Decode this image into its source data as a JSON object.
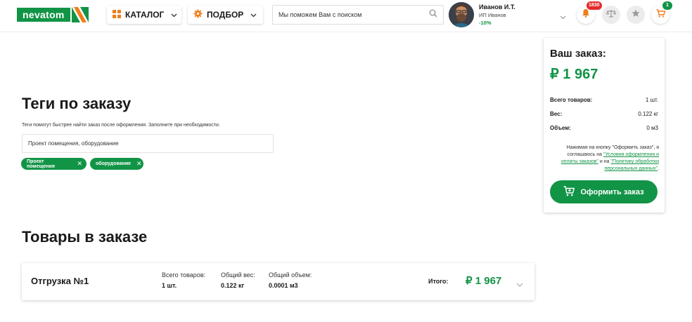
{
  "header": {
    "logo_text": "nevatom",
    "catalog_label": "КАТАЛОГ",
    "podbor_label": "ПОДБОР",
    "search_placeholder": "Мы поможем Вам с поиском",
    "user": {
      "name": "Иванов И.Т.",
      "company": "ИП Иванов",
      "discount": "-10%"
    },
    "notifications_count": "1830",
    "cart_count": "1",
    "colors": {
      "accent": "#119446",
      "accent_orange": "#f07d1a",
      "badge_red": "#e52b2b"
    }
  },
  "tags": {
    "title": "Теги по заказу",
    "hint": "Теги помогут быстрее найти заказ после оформления. Заполните при необходимости.",
    "input_value": "Проект помещения, оборудование",
    "chips": [
      {
        "label": "Проект помещения"
      },
      {
        "label": "оборудование"
      }
    ]
  },
  "goods": {
    "title": "Товары в заказе",
    "shipment": {
      "name": "Отгрузка №1",
      "stats": [
        {
          "label": "Всего товаров:",
          "value": "1 шт."
        },
        {
          "label": "Общий вес:",
          "value": "0.122 кг"
        },
        {
          "label": "Общий объем:",
          "value": "0.0001 м3"
        }
      ],
      "total_label": "Итого:",
      "total_value": "₽ 1 967"
    }
  },
  "order": {
    "title": "Ваш заказ:",
    "sum": "₽ 1 967",
    "rows": [
      {
        "label": "Всего товаров:",
        "value": "1 шт."
      },
      {
        "label": "Вес:",
        "value": "0.122 кг"
      },
      {
        "label": "Объем:",
        "value": "0 м3"
      }
    ],
    "note_prefix": "Нажимая на кнопку \"Оформить заказ\", я соглашаюсь на",
    "note_link1": "\"Условия оформления и оплаты заказов\"",
    "note_middle": "и на",
    "note_link2": "\"Политику обработки персональных данных\"",
    "note_suffix": ".",
    "button_label": "Оформить заказ"
  }
}
